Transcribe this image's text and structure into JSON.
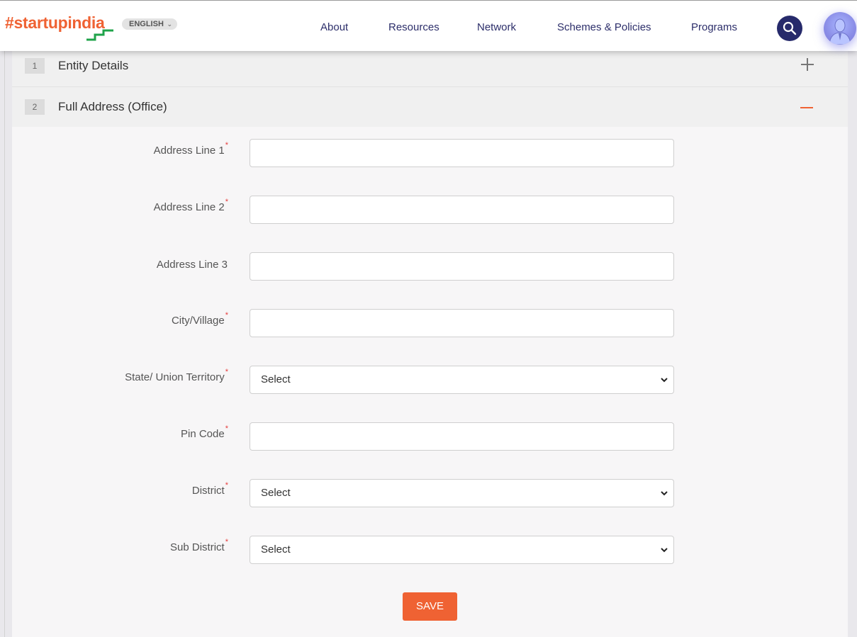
{
  "header": {
    "logo_text_a": "#startup",
    "logo_text_b": "india",
    "language": "ENGLISH",
    "nav": [
      "About",
      "Resources",
      "Network",
      "Schemes & Policies",
      "Programs"
    ]
  },
  "accordion": [
    {
      "num": "1",
      "title": "Entity Details",
      "state": "collapsed"
    },
    {
      "num": "2",
      "title": "Full Address (Office)",
      "state": "expanded"
    }
  ],
  "form": {
    "fields": [
      {
        "label": "Address Line 1",
        "required": "*",
        "type": "text",
        "value": ""
      },
      {
        "label": "Address Line 2",
        "required": "*",
        "type": "text",
        "value": ""
      },
      {
        "label": "Address Line 3",
        "required": "",
        "type": "text",
        "value": ""
      },
      {
        "label": "City/Village",
        "required": "*",
        "type": "text",
        "value": ""
      },
      {
        "label": "State/ Union Territory",
        "required": "*",
        "type": "select",
        "value": "Select"
      },
      {
        "label": "Pin Code",
        "required": "*",
        "type": "text",
        "value": ""
      },
      {
        "label": "District",
        "required": "*",
        "type": "select",
        "value": "Select"
      },
      {
        "label": "Sub District",
        "required": "*",
        "type": "select",
        "value": "Select"
      }
    ],
    "save_label": "SAVE"
  },
  "colors": {
    "accent": "#ef6233",
    "nav_text": "#2c2e6a",
    "search_bg": "#262a6b",
    "required": "#e53c3c"
  }
}
